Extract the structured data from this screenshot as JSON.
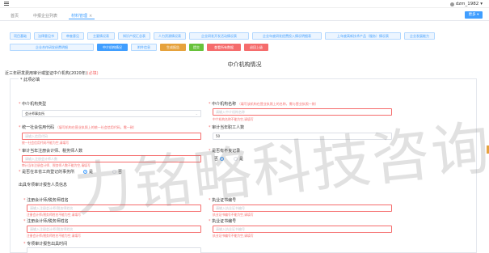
{
  "header": {
    "username": "dzm_1982"
  },
  "tabs": [
    {
      "label": "首页"
    },
    {
      "label": "中报企业列表"
    },
    {
      "label": "材料管理",
      "close": "×"
    }
  ],
  "actions": {
    "more_label": "更多"
  },
  "toolbar": {
    "row1": [
      "项目基础",
      "法律意见书",
      "审查意见",
      "主要情况表",
      "知识产权汇总表",
      "人力资源情况表",
      "企业研发开发活动情况表",
      "企业年度研发经费投入情况明细表",
      "上年度高新技术产品（服务）情况表",
      "企业发展能力"
    ],
    "row2": [
      "企业合作研发经费明细",
      "中介机构情况",
      "附件信息",
      "生成报告",
      "提交",
      "查看所有数据",
      "退回上级"
    ]
  },
  "form": {
    "title": "中介机构情况",
    "subtitle": "近三年研发费用审计或鉴证中介机构(2020年)",
    "subtitle_required": "(必填)",
    "section_title": "此项必填",
    "agency_type_label": "中介机构类型",
    "agency_type_value": "会计师事务所",
    "agency_name_label": "中介机构名称",
    "agency_name_hint": "（填写该机构在营业执照上的名称，需与营业执照一致）",
    "agency_name_placeholder": "请输入中介机构名称",
    "agency_name_error": "中介机构名称不能为空,请填写",
    "credit_code_label": "统一社会信用代码",
    "credit_code_hint": "（填写机构在营业执照上的统一社会信用代码，需一致）",
    "credit_code_placeholder": "请输入信用代码",
    "credit_code_error": "统一社会信用代码不能为空,请填写",
    "staff_count_label": "审计当年职工人数",
    "staff_count_value": "50",
    "certified_staff_label": "审计当年注册会计师、税务师人数",
    "certified_staff_placeholder": "请输入注册会计师人数",
    "certified_staff_error": "审计当年注册会计师、税务师人数不能为空,请填写",
    "bad_record_label": "是否有不良记录",
    "bad_record_options": [
      "否",
      "是"
    ],
    "in_province_label": "是否在本省工商登记的事务所",
    "in_province_options": [
      "是",
      "否"
    ],
    "signer_section": "出具专项审计报告人员信息",
    "cpa1_label": "注册会计师/税务师姓名",
    "cpa1_placeholder": "请输入注册会计师/税务师姓名",
    "cpa1_error": "注册会计师/税务师姓名不能为空,请填写",
    "cert1_label": "执业证书编号",
    "cert1_placeholder": "请输入执业证书编号",
    "cert1_error": "执业证书编号不能为空,请填写",
    "cpa2_label": "注册会计师/税务师姓名",
    "cpa2_placeholder": "请输入注册会计师/税务师姓名",
    "cpa2_error": "注册会计师/税务师姓名不能为空,请填写",
    "cert2_label": "执业证书编号",
    "cert2_placeholder": "请输入执业证书编号",
    "cert2_error": "执业证书编号不能为空,请填写",
    "report_date_label": "专项审计报告出具时间"
  },
  "watermark": "力铭略科技咨询",
  "colors": {
    "primary": "#409eff",
    "danger": "#f56c6c",
    "warning": "#e6a23c",
    "success": "#67c23a"
  }
}
